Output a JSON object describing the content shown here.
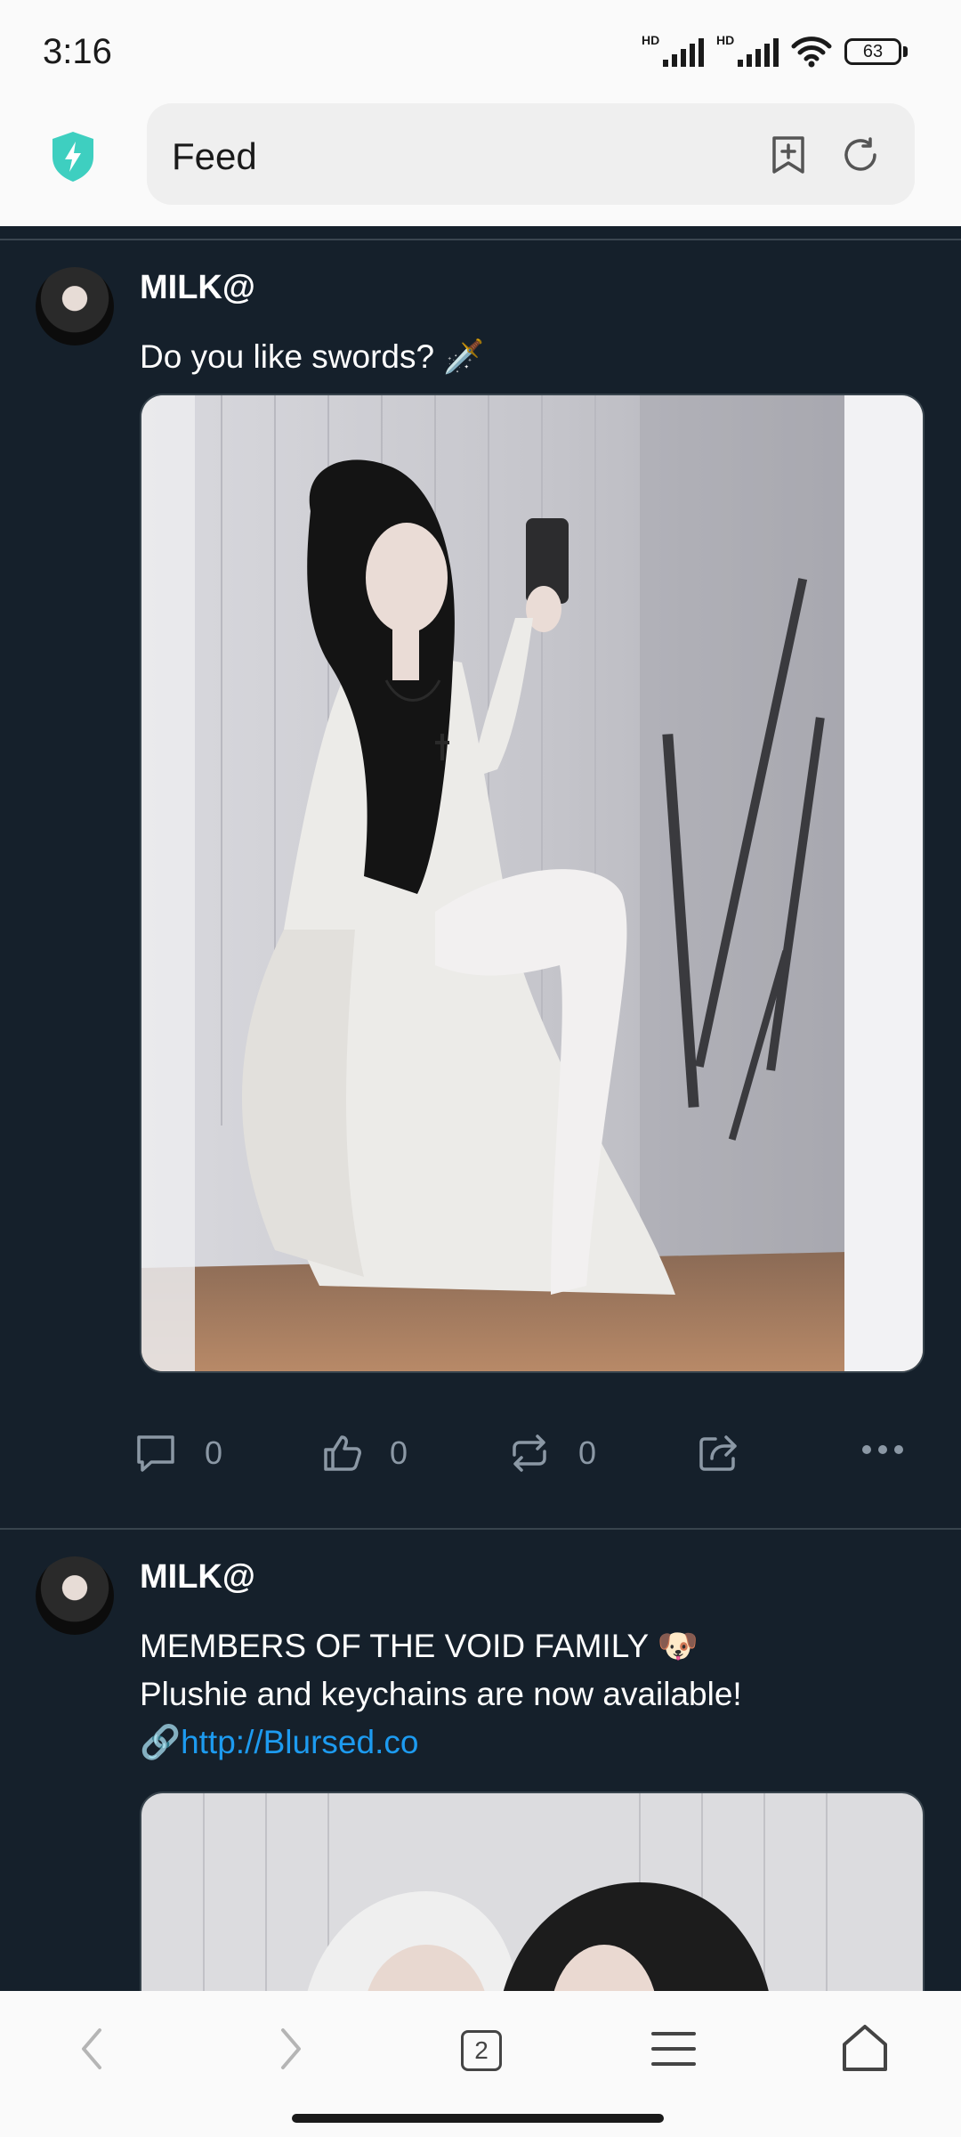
{
  "status_bar": {
    "time": "3:16",
    "signal1_label": "HD",
    "signal2_label": "HD",
    "battery": "63"
  },
  "browser": {
    "address_text": "Feed",
    "tab_count": "2"
  },
  "feed": {
    "posts": [
      {
        "author": "MILK@",
        "text_lines": [
          "Do you like swords? 🗡️"
        ],
        "comments": "0",
        "likes": "0",
        "reposts": "0"
      },
      {
        "author": "MILK@",
        "text_lines": [
          "MEMBERS OF THE VOID FAMILY 🐶",
          "Plushie and keychains are now available!"
        ],
        "link_prefix": "🔗",
        "link": "http://Blursed.co"
      }
    ]
  },
  "colors": {
    "feed_background": "#15202b",
    "link": "#1d9bf0",
    "shield": "#3ecfc0"
  },
  "icons": {
    "shield": "shield-bolt-icon",
    "bookmark": "add-bookmark-icon",
    "reload": "reload-icon",
    "comment": "comment-icon",
    "like": "thumbs-up-icon",
    "repost": "repost-icon",
    "share": "share-icon",
    "more": "more-icon",
    "back": "chevron-left-icon",
    "forward": "chevron-right-icon",
    "menu": "menu-icon",
    "home": "home-icon"
  }
}
